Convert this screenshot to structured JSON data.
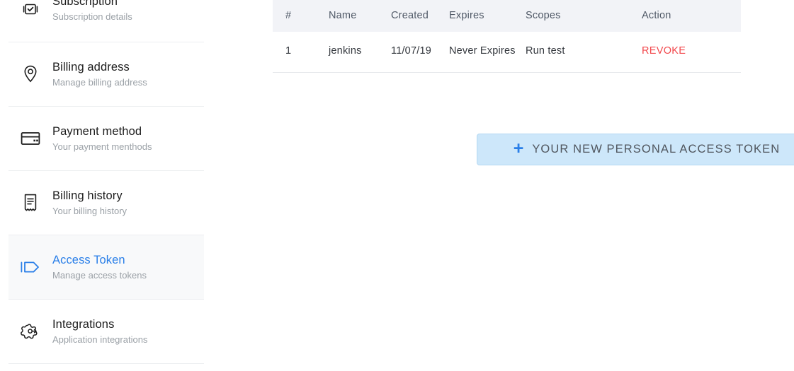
{
  "sidebar": {
    "items": [
      {
        "id": "subscription",
        "icon": "subscription-icon",
        "title": "Subscription",
        "subtitle": "Subscription details",
        "active": false
      },
      {
        "id": "billing-address",
        "icon": "location-pin-icon",
        "title": "Billing address",
        "subtitle": "Manage billing address",
        "active": false
      },
      {
        "id": "payment-method",
        "icon": "credit-card-icon",
        "title": "Payment method",
        "subtitle": "Your payment menthods",
        "active": false
      },
      {
        "id": "billing-history",
        "icon": "receipt-icon",
        "title": "Billing history",
        "subtitle": "Your billing history",
        "active": false
      },
      {
        "id": "access-token",
        "icon": "tag-icon",
        "title": "Access Token",
        "subtitle": "Manage access tokens",
        "active": true
      },
      {
        "id": "integrations",
        "icon": "integrations-icon",
        "title": "Integrations",
        "subtitle": "Application integrations",
        "active": false
      }
    ]
  },
  "main": {
    "table": {
      "columns": [
        "#",
        "Name",
        "Created",
        "Expires",
        "Scopes",
        "Action"
      ],
      "rows": [
        {
          "index": "1",
          "name": "jenkins",
          "created": "11/07/19",
          "expires": "Never Expires",
          "scopes": "Run test",
          "action": "REVOKE"
        }
      ]
    },
    "new_token_button": {
      "icon": "plus-icon",
      "label": "YOUR NEW PERSONAL ACCESS TOKEN"
    },
    "annotation": {
      "icon": "arrow-pointer-annotation",
      "color": "#a35a5c"
    }
  },
  "colors": {
    "accent_blue": "#2a7fe8",
    "button_bg": "#cde7fa",
    "button_border": "#b4d8f2",
    "table_header_bg": "#f2f3f7",
    "revoke_red": "#f2484c",
    "active_item_bg": "#f8f9fa",
    "annotation_red": "#a35a5c"
  }
}
